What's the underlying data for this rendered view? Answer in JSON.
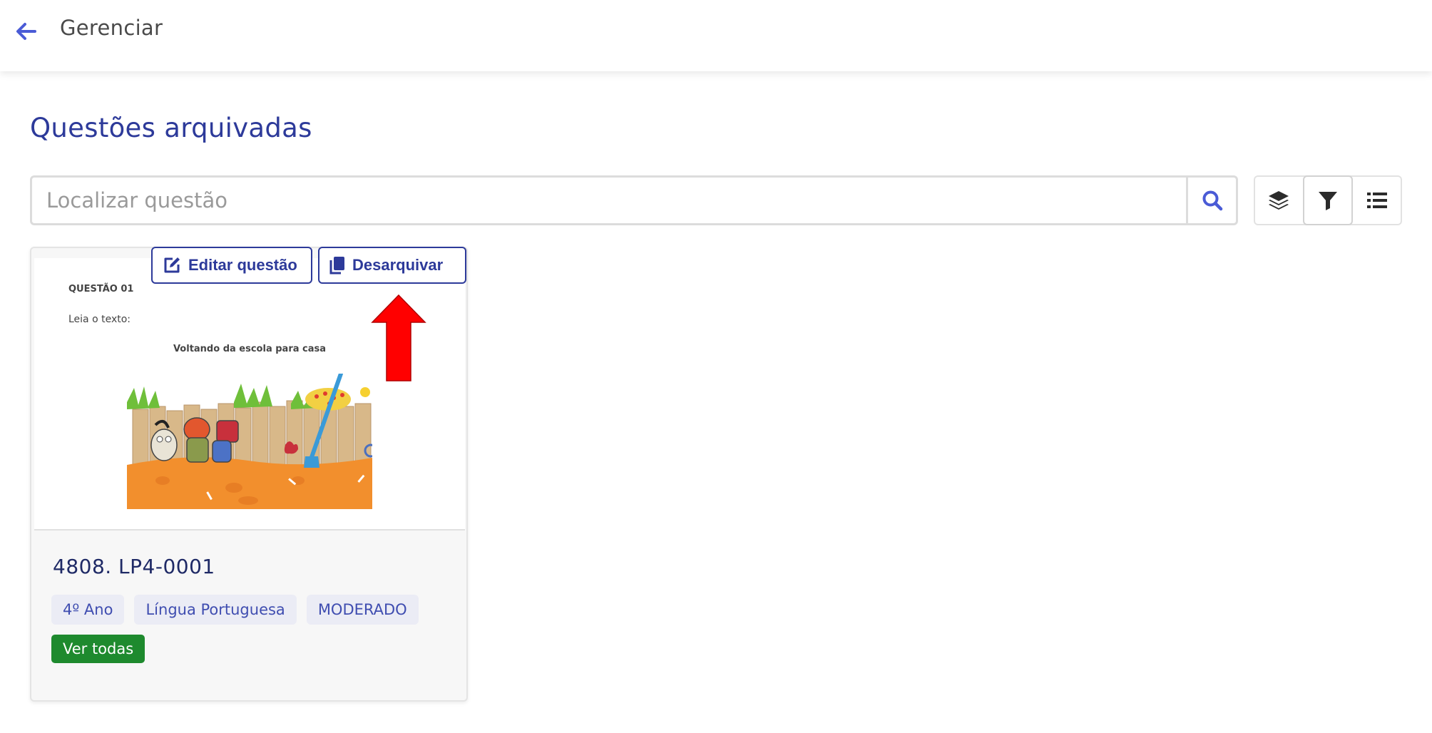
{
  "header": {
    "title": "Gerenciar",
    "back_icon": "arrow-left-icon"
  },
  "page": {
    "title": "Questões arquivadas"
  },
  "search": {
    "placeholder": "Localizar questão",
    "value": "",
    "icon": "search-icon"
  },
  "toolbar": {
    "buttons": [
      {
        "icon": "layers-icon"
      },
      {
        "icon": "filter-icon",
        "active": true
      },
      {
        "icon": "list-icon"
      }
    ]
  },
  "question_card": {
    "preview": {
      "label": "QUESTÃO 01",
      "intro": "Leia o texto:",
      "text_title": "Voltando da escola para casa"
    },
    "edit_label": "Editar questão",
    "unarchive_label": "Desarquivar",
    "code": "4808. LP4-0001",
    "tags": [
      "4º Ano",
      "Língua Portuguesa",
      "MODERADO"
    ],
    "see_all_label": "Ver todas"
  },
  "colors": {
    "primary": "#2d3a9a",
    "accent_icon": "#4a5bd6",
    "tag_bg": "#ebecf5",
    "success": "#1e8a2e",
    "annotation_arrow": "#ff0000"
  }
}
